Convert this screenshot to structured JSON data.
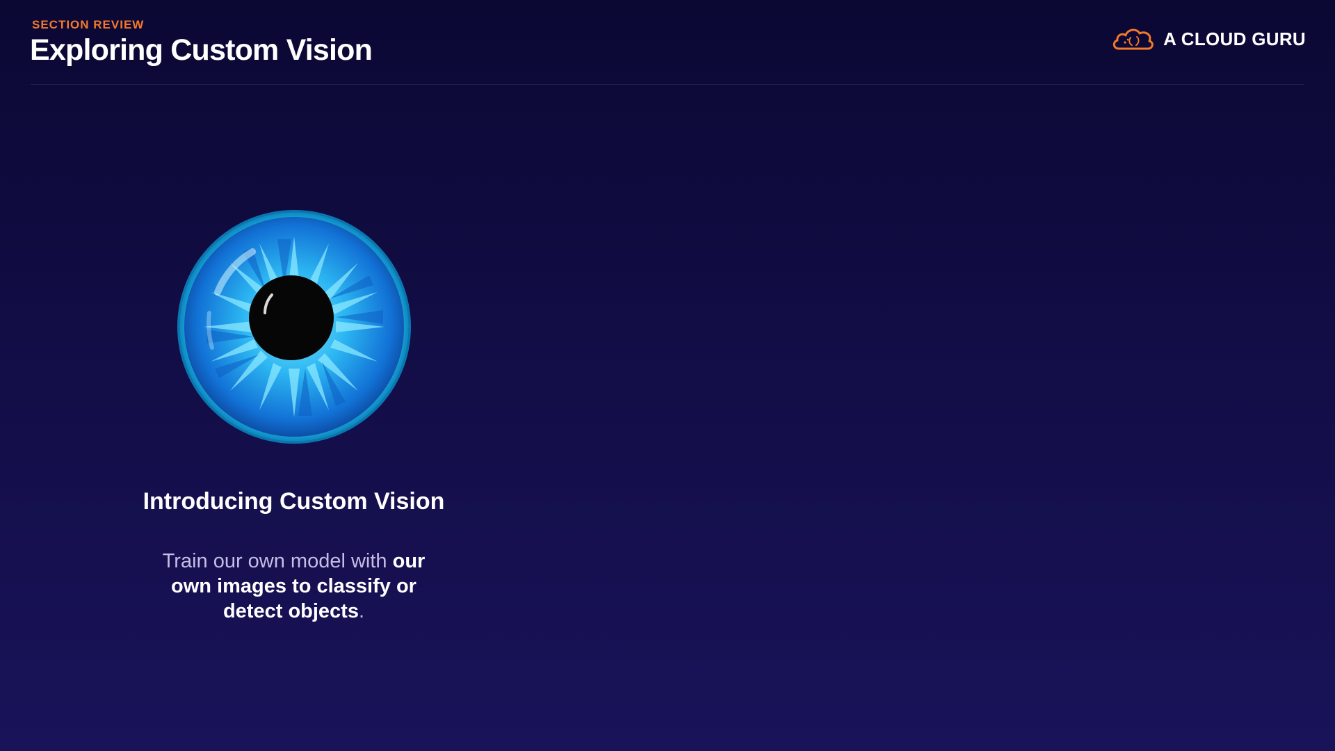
{
  "header": {
    "eyebrow": "SECTION REVIEW",
    "title": "Exploring Custom Vision",
    "brand_name": "A CLOUD GURU",
    "brand_icon": "cloud-logo-icon"
  },
  "colors": {
    "accent": "#f5792a",
    "background_top": "#0b0834",
    "background_bottom": "#19135a",
    "iris": "#1fa3e8"
  },
  "card": {
    "illustration": "eye-icon",
    "title": "Introducing Custom Vision",
    "body_lead": "Train our own model with ",
    "body_emphasis": "our own images to classify or detect objects",
    "body_end": "."
  }
}
